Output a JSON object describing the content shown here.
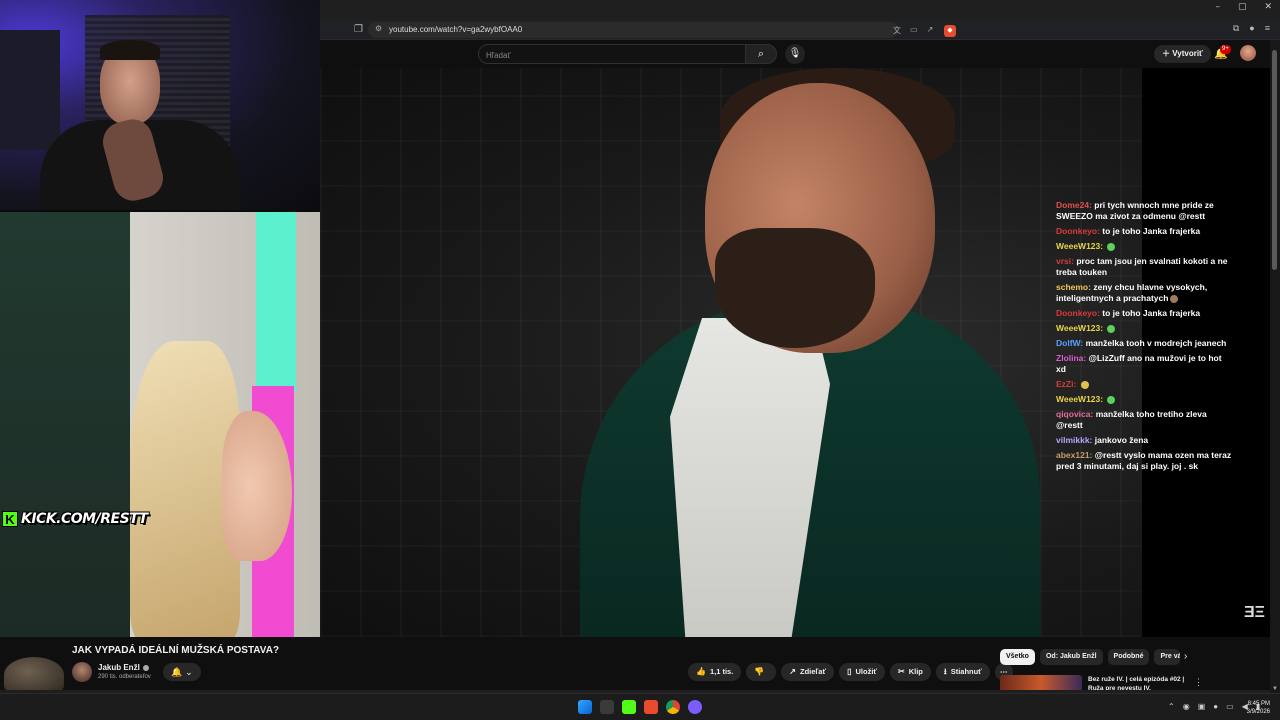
{
  "browser": {
    "url": "youtube.com/watch?v=ga2wybfOAA0",
    "window_controls": [
      "–",
      "▢",
      "✕"
    ]
  },
  "youtube": {
    "search_placeholder": "Hľadať",
    "create_label": "Vytvoriť",
    "notification_badge": "9+"
  },
  "overlay": {
    "kick_url": "KICK.COM/RESTT"
  },
  "chat": [
    {
      "user": "Dome24:",
      "user_color": "#e05050",
      "text": "pri tych wnnoch mne pride ze SWEEZO ma zivot za odmenu @restt"
    },
    {
      "user": "Doonkeyo:",
      "user_color": "#d83b3b",
      "text": "to je toho Janka frajerka"
    },
    {
      "user": "WeeeW123:",
      "user_color": "#e9d54a",
      "text": "",
      "emote": "green"
    },
    {
      "user": "vrsi:",
      "user_color": "#d83b3b",
      "text": "proc tam jsou jen svalnati kokoti a ne treba touken"
    },
    {
      "user": "schemo:",
      "user_color": "#f3c75a",
      "text": "zeny chcu hlavne vysokych, inteligentnych a prachatych",
      "emote": "brown"
    },
    {
      "user": "Doonkeyo:",
      "user_color": "#d83b3b",
      "text": "to je toho Janka frajerka"
    },
    {
      "user": "WeeeW123:",
      "user_color": "#e9d54a",
      "text": "",
      "emote": "green"
    },
    {
      "user": "DolfW:",
      "user_color": "#5aa0ff",
      "text": "manželka tooh v modrejch jeanech"
    },
    {
      "user": "Zlolina:",
      "user_color": "#e25ad2",
      "text": "@LizZuff ano na mužovi je to hot xd"
    },
    {
      "user": "EzZi:",
      "user_color": "#d83b3b",
      "text": "",
      "emote": "yellow"
    },
    {
      "user": "WeeeW123:",
      "user_color": "#e9d54a",
      "text": "",
      "emote": "green"
    },
    {
      "user": "qiqovica:",
      "user_color": "#e86aa0",
      "text": "manželka toho tretiho zleva @restt"
    },
    {
      "user": "vilmikkk:",
      "user_color": "#b9a2ff",
      "text": "jankovo žena"
    },
    {
      "user": "abex121:",
      "user_color": "#c99a6b",
      "text": "@restt vyslo mama ozen ma teraz pred 3 minutami, daj si play. joj . sk"
    }
  ],
  "video": {
    "title": "JAK VYPADÁ IDEÁLNÍ MUŽSKÁ POSTAVA?",
    "channel": "Jakub Enžl",
    "subscribers": "290 tis. odberateľov"
  },
  "actions": {
    "likes": "1,1 tis.",
    "share": "Zdieľať",
    "save": "Uložiť",
    "clip": "Klip",
    "download": "Stiahnuť"
  },
  "chips": [
    "Všetko",
    "Od: Jakub Enžl",
    "Podobné",
    "Pre vás"
  ],
  "recommendation": {
    "title": "Bez ruže IV. | celá epizóda #02 | Ruža pre nevestu IV."
  },
  "taskbar": {
    "time": "8:45 PM",
    "date": "3/9/2026"
  }
}
